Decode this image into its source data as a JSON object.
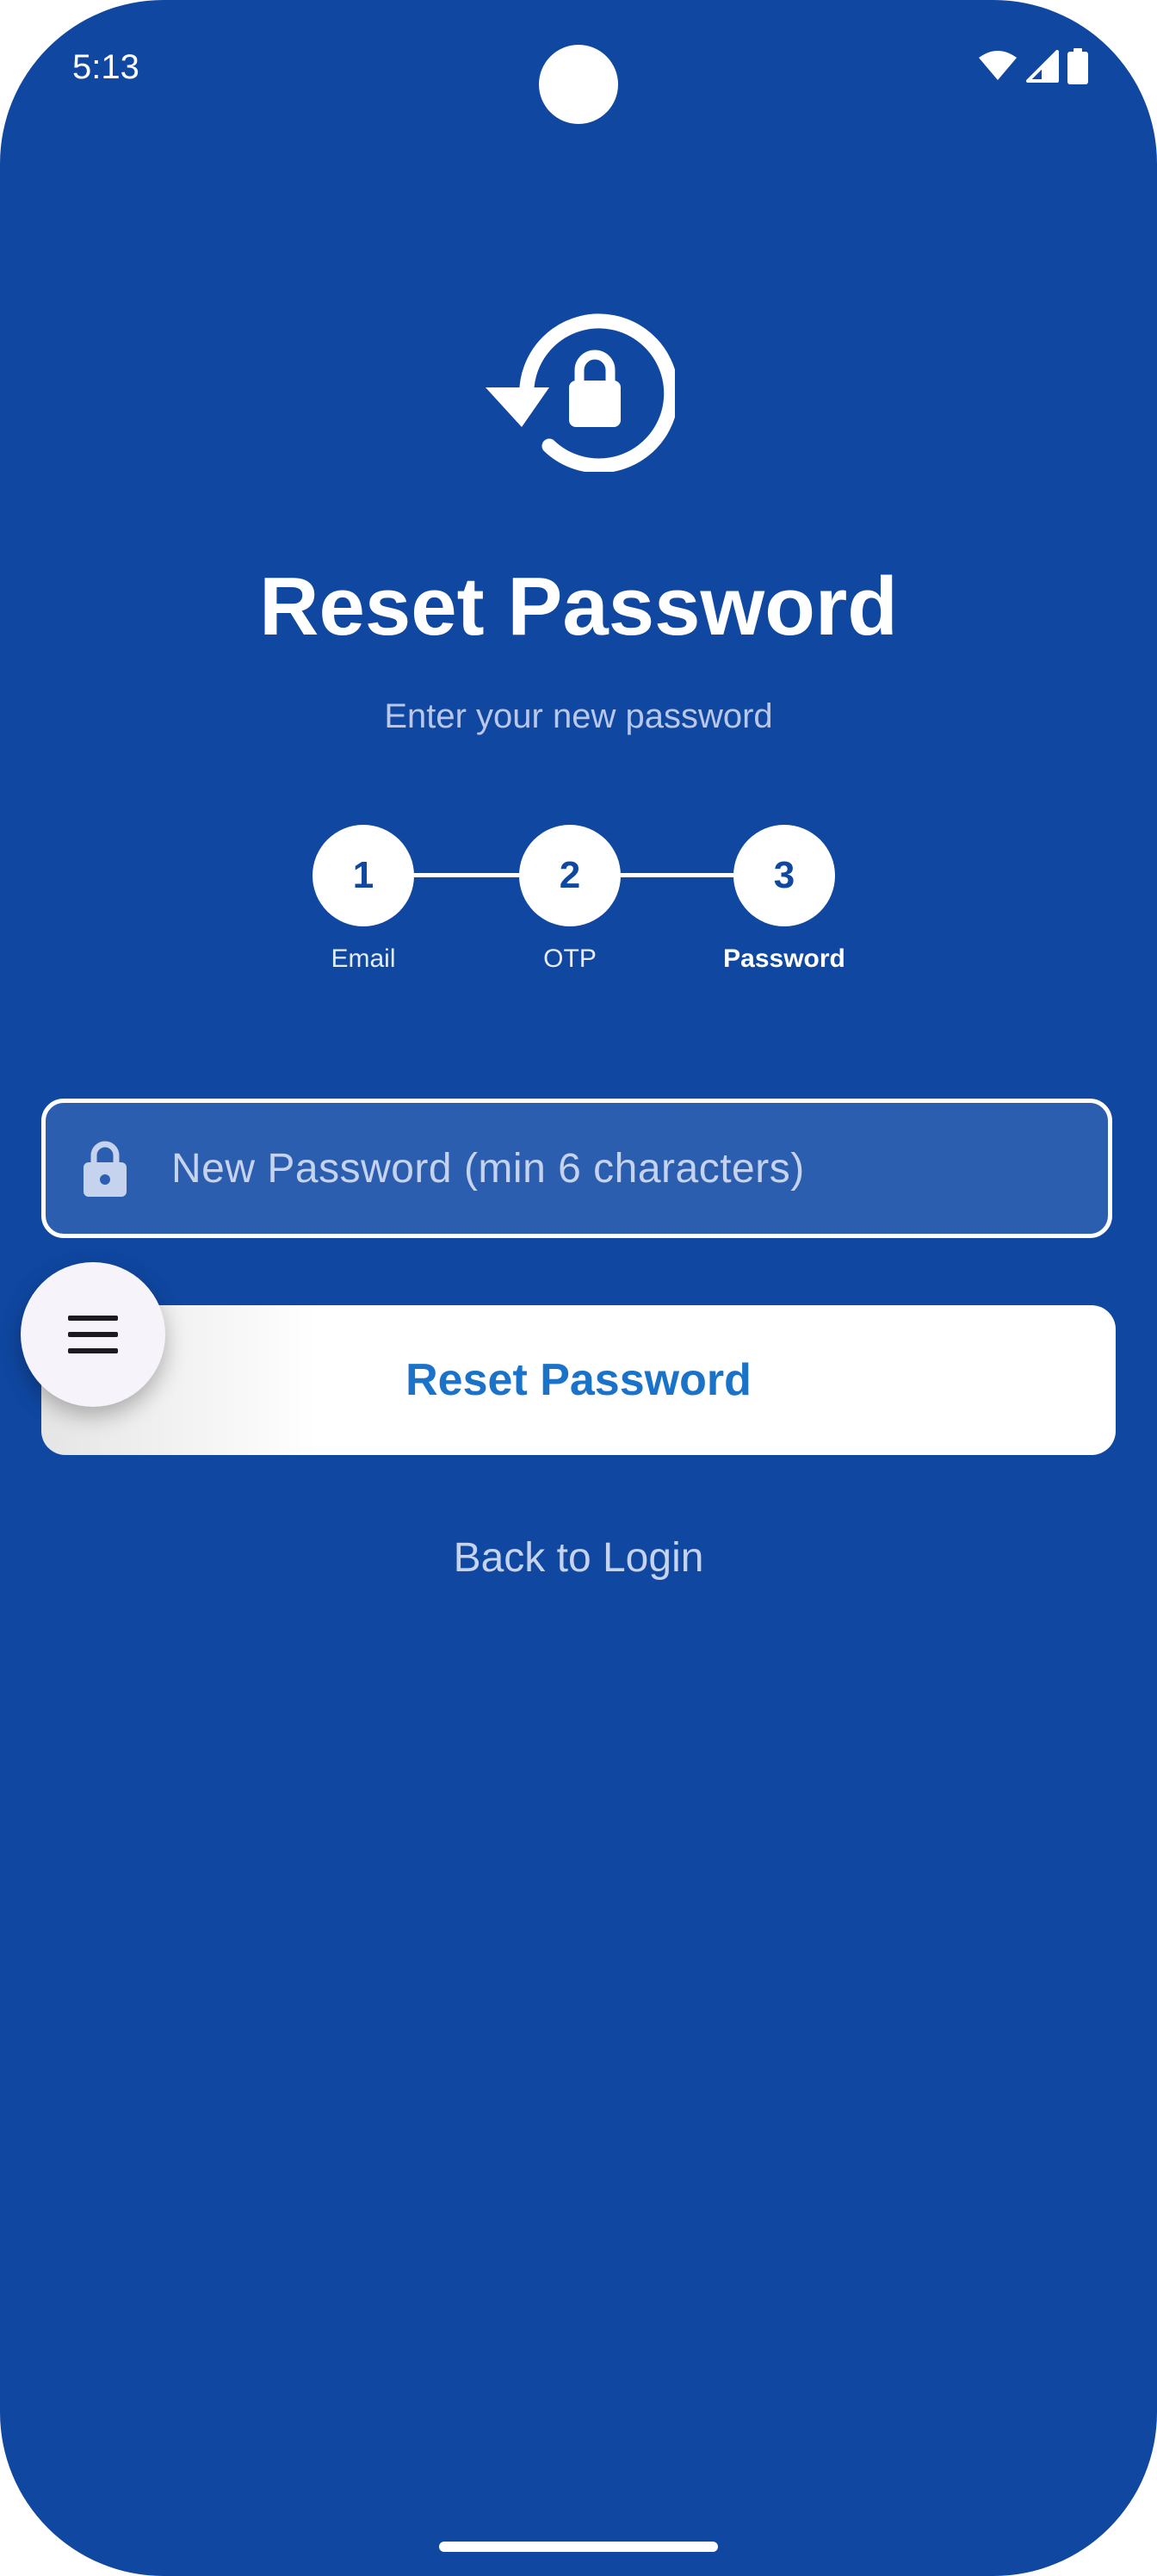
{
  "status_bar": {
    "time": "5:13",
    "icons": [
      "wifi-icon",
      "cellular-signal-icon",
      "battery-icon"
    ]
  },
  "hero": {
    "icon": "lock-reset-icon"
  },
  "header": {
    "title": "Reset Password",
    "subtitle": "Enter your new password"
  },
  "stepper": {
    "steps": [
      {
        "number": "1",
        "label": "Email"
      },
      {
        "number": "2",
        "label": "OTP"
      },
      {
        "number": "3",
        "label": "Password"
      }
    ],
    "active_step": 3
  },
  "form": {
    "password_placeholder": "New Password (min 6 characters)",
    "password_value": "",
    "field_icon": "lock-icon",
    "submit_label": "Reset Password"
  },
  "fab": {
    "icon": "menu-icon"
  },
  "footer": {
    "back_link": "Back to Login"
  },
  "colors": {
    "background": "#0f47a1",
    "button_text": "#1a73c9",
    "field_fill": "#2c5eaf",
    "muted_text": "#c6d3ee"
  }
}
